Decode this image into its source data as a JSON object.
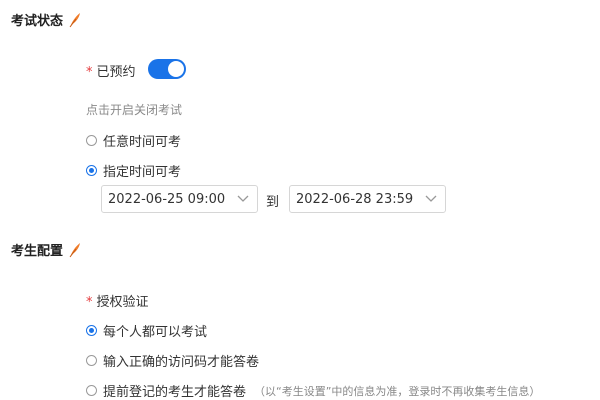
{
  "exam_status": {
    "title": "考试状态",
    "icon": "feather-icon",
    "reservation": {
      "required_mark": "*",
      "label": "已预约",
      "enabled": true,
      "accent": "#1a73e8"
    },
    "hint": "点击开启关闭考试",
    "options": [
      {
        "label": "任意时间可考",
        "checked": false
      },
      {
        "label": "指定时间可考",
        "checked": true
      }
    ],
    "time_range": {
      "start": "2022-06-25 09:00",
      "separator": "到",
      "end": "2022-06-28 23:59"
    }
  },
  "candidate_config": {
    "title": "考生配置",
    "icon": "feather-icon",
    "auth": {
      "required_mark": "*",
      "label": "授权验证"
    },
    "options": [
      {
        "label": "每个人都可以考试",
        "checked": true
      },
      {
        "label": "输入正确的访问码才能答卷",
        "checked": false
      },
      {
        "label": "提前登记的考生才能答卷",
        "note": "（以“考生设置”中的信息为准，登录时不再收集考生信息）",
        "checked": false
      }
    ]
  }
}
